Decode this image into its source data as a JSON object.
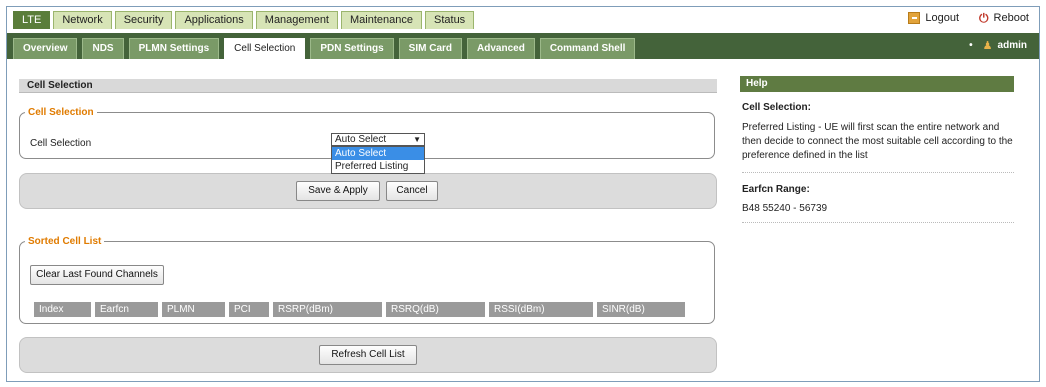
{
  "main_tabs": [
    "LTE",
    "Network",
    "Security",
    "Applications",
    "Management",
    "Maintenance",
    "Status"
  ],
  "top_links": {
    "logout": "Logout",
    "reboot": "Reboot"
  },
  "sub_tabs": [
    "Overview",
    "NDS",
    "PLMN Settings",
    "Cell Selection",
    "PDN Settings",
    "SIM Card",
    "Advanced",
    "Command Shell"
  ],
  "user": {
    "name": "admin"
  },
  "section": {
    "title": "Cell Selection"
  },
  "cell_selection": {
    "legend": "Cell Selection",
    "label": "Cell Selection",
    "selected": "Auto Select",
    "options": [
      "Auto Select",
      "Preferred Listing"
    ]
  },
  "buttons": {
    "save": "Save & Apply",
    "cancel": "Cancel",
    "clear": "Clear Last Found Channels",
    "refresh": "Refresh Cell List"
  },
  "sorted_list": {
    "legend": "Sorted Cell List",
    "columns": [
      "Index",
      "Earfcn",
      "PLMN",
      "PCI",
      "RSRP(dBm)",
      "RSRQ(dB)",
      "RSSI(dBm)",
      "SINR(dB)"
    ]
  },
  "help": {
    "title": "Help",
    "cell_selection_title": "Cell Selection:",
    "cell_selection_text": "Preferred Listing - UE will first scan the entire network and then decide to connect the most suitable cell according to the preference defined in the list",
    "earfcn_title": "Earfcn Range:",
    "earfcn_text": "B48 55240 - 56739"
  }
}
